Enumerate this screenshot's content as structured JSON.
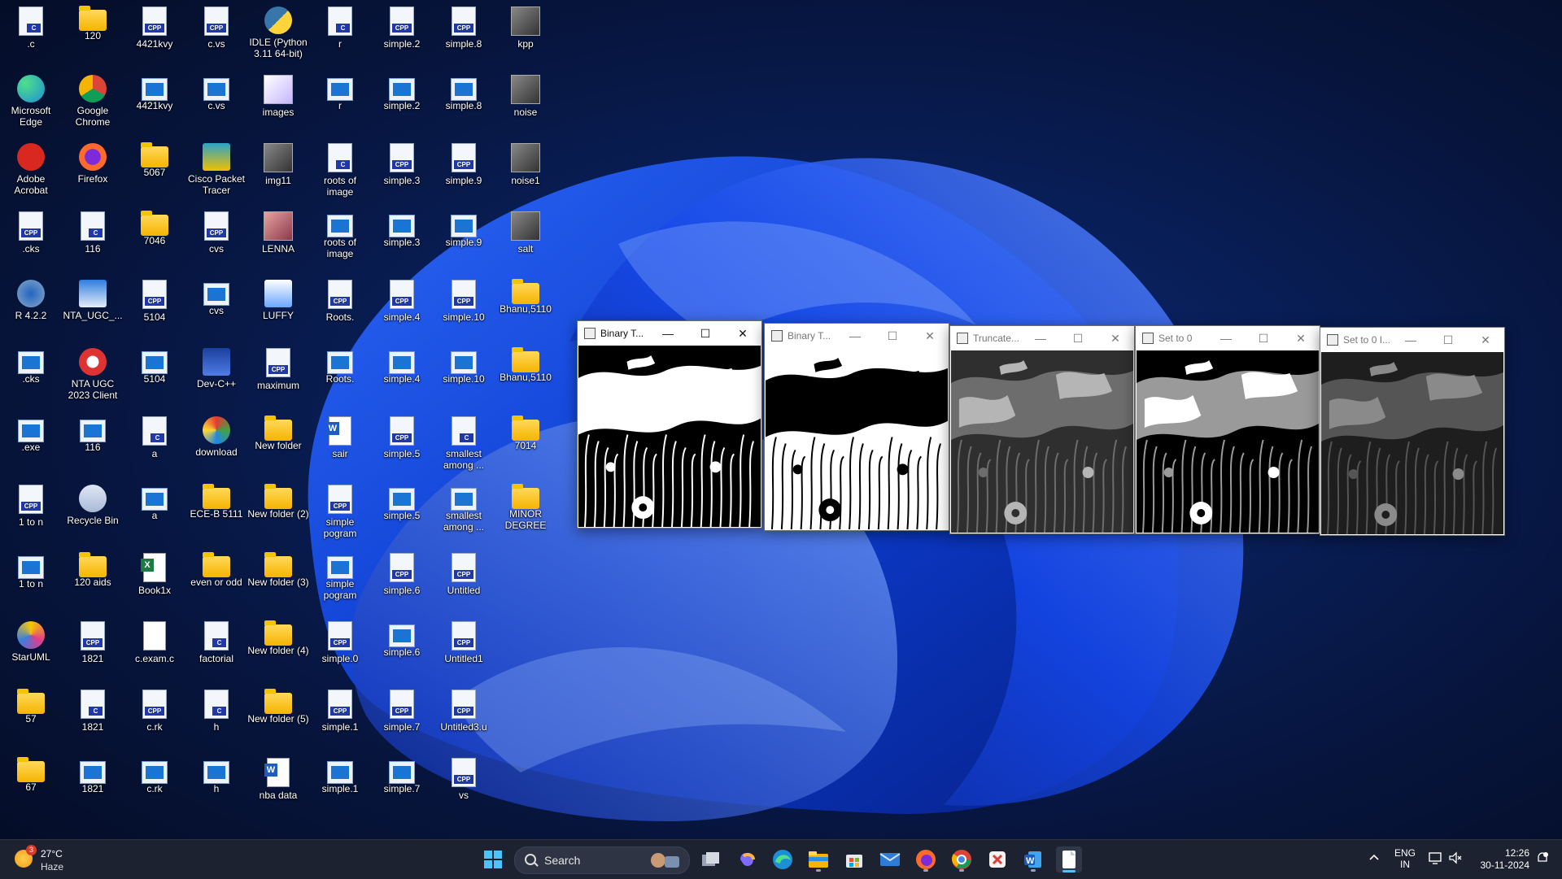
{
  "desktop": {
    "icons": [
      {
        "label": ".c",
        "type": "c"
      },
      {
        "label": "Microsoft Edge",
        "type": "edge"
      },
      {
        "label": "Adobe Acrobat",
        "type": "acrobat"
      },
      {
        "label": ".cks",
        "type": "cpp"
      },
      {
        "label": "R 4.2.2",
        "type": "r"
      },
      {
        "label": ".cks",
        "type": "exe"
      },
      {
        "label": ".exe",
        "type": "exe"
      },
      {
        "label": "1 to n",
        "type": "cpp"
      },
      {
        "label": "1 to n",
        "type": "exe"
      },
      {
        "label": "StarUML",
        "type": "staruml"
      },
      {
        "label": "57",
        "type": "folder"
      },
      {
        "label": "67",
        "type": "folder"
      },
      {
        "label": "120",
        "type": "folder"
      },
      {
        "label": "Google Chrome",
        "type": "chrome"
      },
      {
        "label": "Firefox",
        "type": "firefox"
      },
      {
        "label": "116",
        "type": "c"
      },
      {
        "label": "NTA_UGC_...",
        "type": "nta"
      },
      {
        "label": "NTA UGC 2023 Client",
        "type": "ntaclient"
      },
      {
        "label": "116",
        "type": "exe"
      },
      {
        "label": "Recycle Bin",
        "type": "recycle"
      },
      {
        "label": "120 aids",
        "type": "folder"
      },
      {
        "label": "1821",
        "type": "cpp"
      },
      {
        "label": "1821",
        "type": "c"
      },
      {
        "label": "1821",
        "type": "exe"
      },
      {
        "label": "4421kvy",
        "type": "cpp"
      },
      {
        "label": "4421kvy",
        "type": "exe"
      },
      {
        "label": "5067",
        "type": "folder"
      },
      {
        "label": "7046",
        "type": "folder"
      },
      {
        "label": "5104",
        "type": "cpp"
      },
      {
        "label": "5104",
        "type": "exe"
      },
      {
        "label": "a",
        "type": "c"
      },
      {
        "label": "a",
        "type": "exe"
      },
      {
        "label": "Book1x",
        "type": "excel"
      },
      {
        "label": "c.exam.c",
        "type": "doc"
      },
      {
        "label": "c.rk",
        "type": "cpp"
      },
      {
        "label": "c.rk",
        "type": "exe"
      },
      {
        "label": "c.vs",
        "type": "cpp"
      },
      {
        "label": "c.vs",
        "type": "exe"
      },
      {
        "label": "Cisco Packet Tracer",
        "type": "cisco"
      },
      {
        "label": "cvs",
        "type": "cpp"
      },
      {
        "label": "cvs",
        "type": "exe"
      },
      {
        "label": "Dev-C++",
        "type": "devcpp"
      },
      {
        "label": "download",
        "type": "download"
      },
      {
        "label": "ECE-B 5111",
        "type": "folder"
      },
      {
        "label": "even or odd",
        "type": "folder"
      },
      {
        "label": "factorial",
        "type": "c"
      },
      {
        "label": "h",
        "type": "c"
      },
      {
        "label": "h",
        "type": "exe"
      },
      {
        "label": "IDLE (Python 3.11 64-bit)",
        "type": "python"
      },
      {
        "label": "images",
        "type": "images"
      },
      {
        "label": "img11",
        "type": "img"
      },
      {
        "label": "LENNA",
        "type": "lenna"
      },
      {
        "label": "LUFFY",
        "type": "luffy"
      },
      {
        "label": "maximum",
        "type": "cpp"
      },
      {
        "label": "New folder",
        "type": "folder"
      },
      {
        "label": "New folder (2)",
        "type": "folder"
      },
      {
        "label": "New folder (3)",
        "type": "folder"
      },
      {
        "label": "New folder (4)",
        "type": "folder"
      },
      {
        "label": "New folder (5)",
        "type": "folder"
      },
      {
        "label": "nba data",
        "type": "word"
      },
      {
        "label": "r",
        "type": "c"
      },
      {
        "label": "r",
        "type": "exe"
      },
      {
        "label": "roots of image",
        "type": "c"
      },
      {
        "label": "roots of image",
        "type": "exe"
      },
      {
        "label": "Roots.",
        "type": "cpp"
      },
      {
        "label": "Roots.",
        "type": "exe"
      },
      {
        "label": "sair",
        "type": "word"
      },
      {
        "label": "simple pogram",
        "type": "cpp"
      },
      {
        "label": "simple pogram",
        "type": "exe"
      },
      {
        "label": "simple.0",
        "type": "cpp"
      },
      {
        "label": "simple.1",
        "type": "cpp"
      },
      {
        "label": "simple.1",
        "type": "exe"
      },
      {
        "label": "simple.2",
        "type": "cpp"
      },
      {
        "label": "simple.2",
        "type": "exe"
      },
      {
        "label": "simple.3",
        "type": "cpp"
      },
      {
        "label": "simple.3",
        "type": "exe"
      },
      {
        "label": "simple.4",
        "type": "cpp"
      },
      {
        "label": "simple.4",
        "type": "exe"
      },
      {
        "label": "simple.5",
        "type": "cpp"
      },
      {
        "label": "simple.5",
        "type": "exe"
      },
      {
        "label": "simple.6",
        "type": "cpp"
      },
      {
        "label": "simple.6",
        "type": "exe"
      },
      {
        "label": "simple.7",
        "type": "cpp"
      },
      {
        "label": "simple.7",
        "type": "exe"
      },
      {
        "label": "simple.8",
        "type": "cpp"
      },
      {
        "label": "simple.8",
        "type": "exe"
      },
      {
        "label": "simple.9",
        "type": "cpp"
      },
      {
        "label": "simple.9",
        "type": "exe"
      },
      {
        "label": "simple.10",
        "type": "cpp"
      },
      {
        "label": "simple.10",
        "type": "exe"
      },
      {
        "label": "smallest among ...",
        "type": "c"
      },
      {
        "label": "smallest among ...",
        "type": "exe"
      },
      {
        "label": "Untitled",
        "type": "cpp"
      },
      {
        "label": "Untitled1",
        "type": "cpp"
      },
      {
        "label": "Untitled3.u",
        "type": "cpp"
      },
      {
        "label": "vs",
        "type": "cpp"
      },
      {
        "label": "kpp",
        "type": "img"
      },
      {
        "label": "noise",
        "type": "img"
      },
      {
        "label": "noise1",
        "type": "img"
      },
      {
        "label": "salt",
        "type": "img"
      },
      {
        "label": "Bhanu,5110",
        "type": "folder"
      },
      {
        "label": "Bhanu,5110",
        "type": "folder"
      },
      {
        "label": "7014",
        "type": "folder"
      },
      {
        "label": "MINOR DEGREE",
        "type": "folder"
      }
    ]
  },
  "windows": [
    {
      "title": "Binary T...",
      "variant": "binary",
      "active": true
    },
    {
      "title": "Binary T...",
      "variant": "binary_inv",
      "active": false
    },
    {
      "title": "Truncate...",
      "variant": "trunc",
      "active": false
    },
    {
      "title": "Set to 0",
      "variant": "tozero",
      "active": false
    },
    {
      "title": "Set to 0 I...",
      "variant": "tozero_inv",
      "active": false
    }
  ],
  "window_controls": {
    "minimize": "—",
    "maximize": "☐",
    "close": "✕"
  },
  "taskbar": {
    "weather": {
      "temp": "27°C",
      "condition": "Haze",
      "badge": "3"
    },
    "search_placeholder": "Search",
    "apps": [
      {
        "name": "start-button"
      },
      {
        "name": "task-view"
      },
      {
        "name": "copilot"
      },
      {
        "name": "edge"
      },
      {
        "name": "file-explorer"
      },
      {
        "name": "store"
      },
      {
        "name": "mail"
      },
      {
        "name": "firefox"
      },
      {
        "name": "chrome"
      },
      {
        "name": "snipping-tool"
      },
      {
        "name": "word"
      },
      {
        "name": "notepad"
      }
    ],
    "language": {
      "line1": "ENG",
      "line2": "IN"
    },
    "clock": {
      "time": "12:26",
      "date": "30-11-2024"
    }
  },
  "colors": {
    "accent": "#4cc2ff",
    "taskbar": "#1c2230",
    "wallpaper_blue": "#1a4dff"
  }
}
